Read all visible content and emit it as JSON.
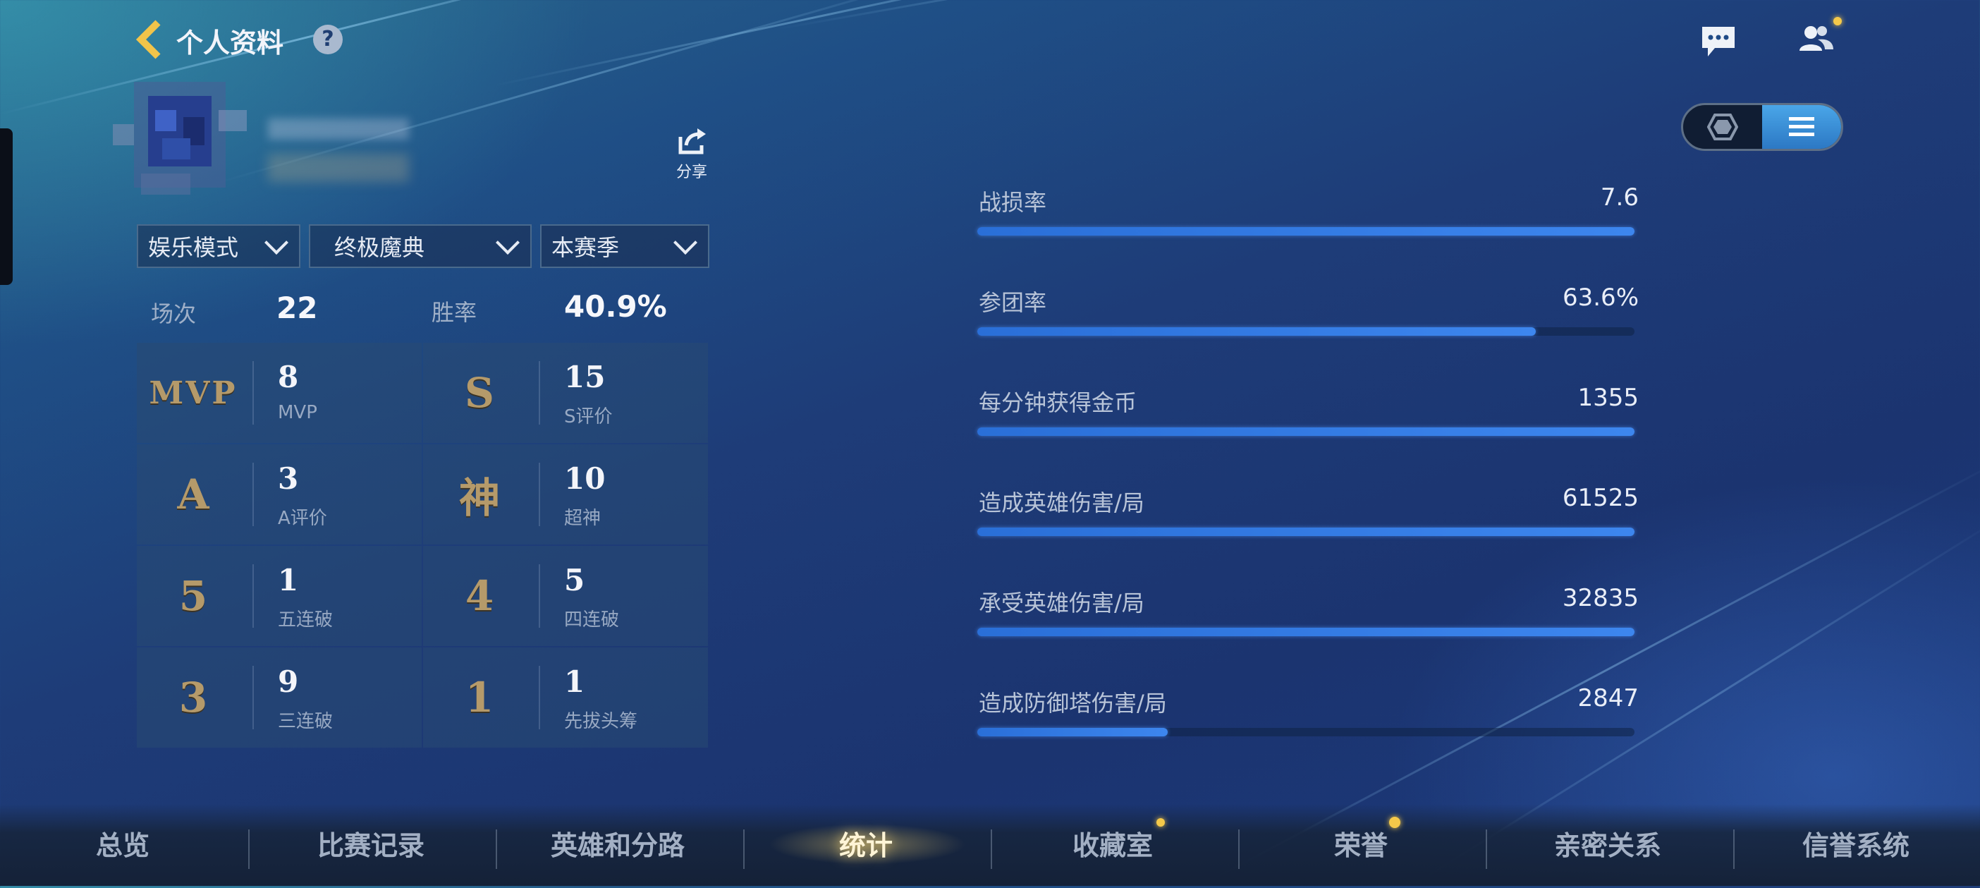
{
  "header": {
    "title": "个人资料",
    "help_icon": "?",
    "icons": [
      "back-chevron-icon",
      "help-icon",
      "chat-icon",
      "friends-icon"
    ]
  },
  "profile": {
    "share_label": "分享"
  },
  "filters": [
    {
      "label": "娱乐模式"
    },
    {
      "label": "终极魔典"
    },
    {
      "label": "本赛季"
    }
  ],
  "summary": {
    "matches_label": "场次",
    "matches_value": "22",
    "winrate_label": "胜率",
    "winrate_value": "40.9%"
  },
  "badges": [
    {
      "glyph": "MVP",
      "value": "8",
      "label": "MVP"
    },
    {
      "glyph": "S",
      "value": "15",
      "label": "S评价"
    },
    {
      "glyph": "A",
      "value": "3",
      "label": "A评价"
    },
    {
      "glyph": "神",
      "value": "10",
      "label": "超神"
    },
    {
      "glyph": "5",
      "value": "1",
      "label": "五连破"
    },
    {
      "glyph": "4",
      "value": "5",
      "label": "四连破"
    },
    {
      "glyph": "3",
      "value": "9",
      "label": "三连破"
    },
    {
      "glyph": "1",
      "value": "1",
      "label": "先拔头筹"
    }
  ],
  "stats": [
    {
      "label": "战损率",
      "value": "7.6",
      "fill": 1.0
    },
    {
      "label": "参团率",
      "value": "63.6%",
      "fill": 0.85
    },
    {
      "label": "每分钟获得金币",
      "value": "1355",
      "fill": 1.0
    },
    {
      "label": "造成英雄伤害/局",
      "value": "61525",
      "fill": 1.0
    },
    {
      "label": "承受英雄伤害/局",
      "value": "32835",
      "fill": 1.0
    },
    {
      "label": "造成防御塔伤害/局",
      "value": "2847",
      "fill": 0.29
    }
  ],
  "nav": {
    "tabs": [
      {
        "label": "总览",
        "active": false,
        "dot": false
      },
      {
        "label": "比赛记录",
        "active": false,
        "dot": false
      },
      {
        "label": "英雄和分路",
        "active": false,
        "dot": false
      },
      {
        "label": "统计",
        "active": true,
        "dot": false
      },
      {
        "label": "收藏室",
        "active": false,
        "dot": true
      },
      {
        "label": "荣誉",
        "active": false,
        "dot": true
      },
      {
        "label": "亲密关系",
        "active": false,
        "dot": false
      },
      {
        "label": "信誉系统",
        "active": false,
        "dot": false
      }
    ]
  },
  "colors": {
    "accent_bar": "#3d86ee",
    "badge_gold": "#b59a6a",
    "notify_dot": "#f5c94a"
  }
}
